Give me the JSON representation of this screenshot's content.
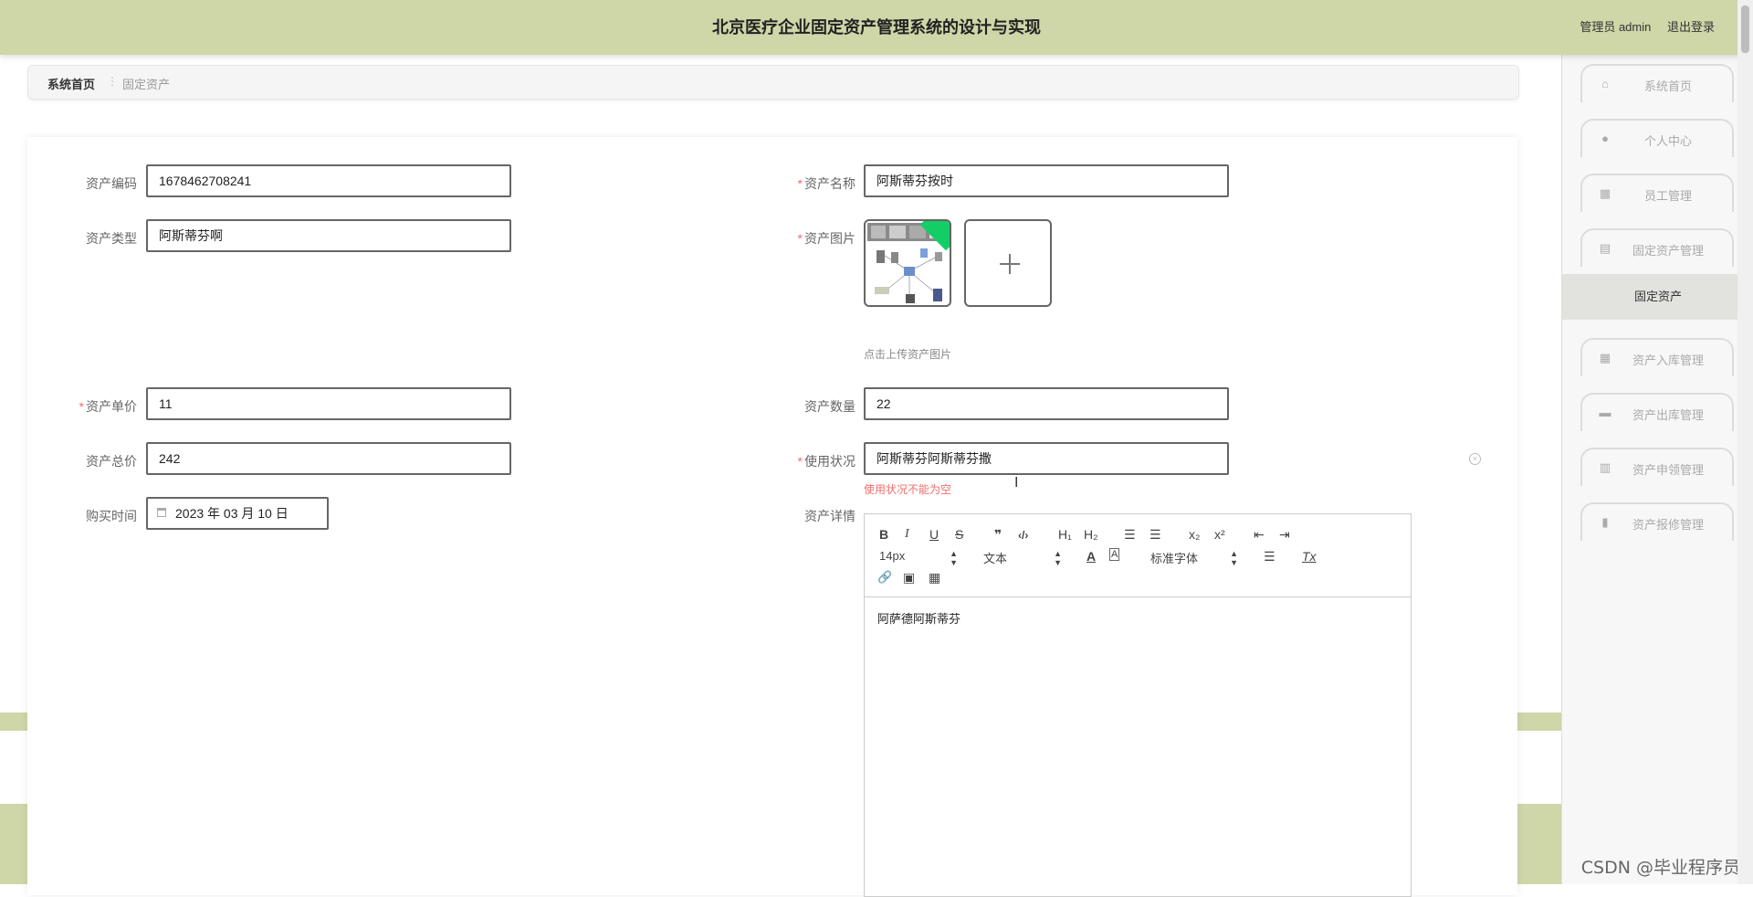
{
  "header": {
    "title": "北京医疗企业固定资产管理系统的设计与实现",
    "user_label": "管理员 admin",
    "logout_label": "退出登录"
  },
  "breadcrumb": {
    "home": "系统首页",
    "separator": "⋮",
    "current": "固定资产"
  },
  "form": {
    "asset_code": {
      "label": "资产编码",
      "value": "1678462708241"
    },
    "asset_name": {
      "label": "资产名称",
      "value": "阿斯蒂芬按时"
    },
    "asset_type": {
      "label": "资产类型",
      "value": "阿斯蒂芬啊"
    },
    "asset_image": {
      "label": "资产图片",
      "hint": "点击上传资产图片"
    },
    "unit_price": {
      "label": "资产单价",
      "value": "11"
    },
    "quantity": {
      "label": "资产数量",
      "value": "22"
    },
    "total_price": {
      "label": "资产总价",
      "value": "242"
    },
    "usage_status": {
      "label": "使用状况",
      "value": "阿斯蒂芬阿斯蒂芬撒",
      "error": "使用状况不能为空"
    },
    "purchase_date": {
      "label": "购买时间",
      "value": "2023 年 03 月 10 日"
    },
    "details": {
      "label": "资产详情",
      "content": "阿萨德阿斯蒂芬"
    }
  },
  "editor_toolbar": {
    "bold": "B",
    "italic": "I",
    "underline": "U",
    "strike": "S",
    "quote": "❞",
    "code": "‹/›",
    "h1": "H₁",
    "h2": "H₂",
    "ordered_list": "☰",
    "bullet_list": "☰",
    "subscript": "x₂",
    "superscript": "x²",
    "outdent": "⇤",
    "indent": "⇥",
    "font_size": "14px",
    "text_style": "文本",
    "font_family": "标准字体",
    "font_color": "A",
    "background": "A",
    "align": "☰",
    "clean": "Tx",
    "link": "🔗",
    "image": "▣",
    "video": "▦"
  },
  "sidebar": {
    "items": [
      {
        "label": "系统首页",
        "icon": "home-icon",
        "glyph": "⌂"
      },
      {
        "label": "个人中心",
        "icon": "user-icon",
        "glyph": "●"
      },
      {
        "label": "员工管理",
        "icon": "grid-icon",
        "glyph": "▦"
      },
      {
        "label": "固定资产管理",
        "icon": "clipboard-icon",
        "glyph": "▤"
      },
      {
        "label": "资产入库管理",
        "icon": "grid-icon",
        "glyph": "▦"
      },
      {
        "label": "资产出库管理",
        "icon": "briefcase-icon",
        "glyph": "▬"
      },
      {
        "label": "资产申领管理",
        "icon": "building-icon",
        "glyph": "▥"
      },
      {
        "label": "资产报修管理",
        "icon": "bar-chart-icon",
        "glyph": "▮"
      }
    ],
    "active_sub": "固定资产"
  },
  "watermark": "CSDN @毕业程序员",
  "colors": {
    "header_bg": "#cfd6a8",
    "required": "#f56c6c",
    "upload_success": "#13ce66"
  }
}
